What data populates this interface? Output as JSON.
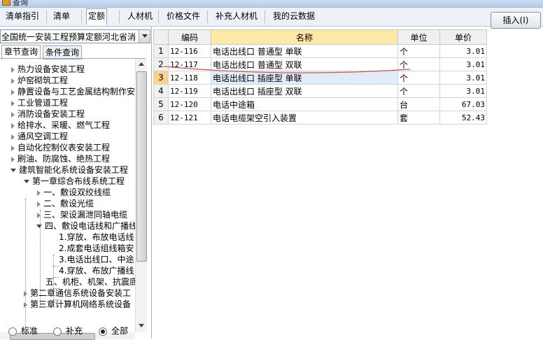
{
  "window": {
    "title": "查询"
  },
  "tabs": [
    {
      "label": "清单指引",
      "active": false
    },
    {
      "label": "清单",
      "active": false
    },
    {
      "label": "定额",
      "active": true
    },
    {
      "label": "人材机",
      "active": false
    },
    {
      "label": "价格文件",
      "active": false
    },
    {
      "label": "补充人材机",
      "active": false
    },
    {
      "label": "我的云数据",
      "active": false
    }
  ],
  "insert_button": "插入(I)",
  "library": {
    "selected": "全国统一安装工程预算定额河北省消"
  },
  "subtabs": [
    {
      "label": "章节查询",
      "active": true
    },
    {
      "label": "条件查询",
      "active": false
    }
  ],
  "tree": [
    {
      "label": "热力设备安装工程",
      "state": "closed"
    },
    {
      "label": "炉窑砌筑工程",
      "state": "closed"
    },
    {
      "label": "静置设备与工艺金属结构制作安",
      "state": "closed"
    },
    {
      "label": "工业管道工程",
      "state": "closed"
    },
    {
      "label": "消防设备安装工程",
      "state": "closed"
    },
    {
      "label": "给排水、采暖、燃气工程",
      "state": "closed"
    },
    {
      "label": "通风空调工程",
      "state": "closed"
    },
    {
      "label": "自动化控制仪表安装工程",
      "state": "closed"
    },
    {
      "label": "刷油、防腐蚀、绝热工程",
      "state": "closed"
    },
    {
      "label": "建筑智能化系统设备安装工程",
      "state": "open"
    },
    {
      "label": "第一章综合布线系统工程",
      "state": "open"
    },
    {
      "label": "一、敷设双绞线缆",
      "state": "closed"
    },
    {
      "label": "二、敷设光缆",
      "state": "closed"
    },
    {
      "label": "三、架设漏泄同轴电缆",
      "state": "closed"
    },
    {
      "label": "四、敷设电话线和广播线",
      "state": "open"
    },
    {
      "label": "1.穿放、布放电话线",
      "state": "leaf"
    },
    {
      "label": "2.成套电话组线箱安",
      "state": "leaf"
    },
    {
      "label": "3.电话出线口、中途",
      "state": "leaf"
    },
    {
      "label": "4.穿放、布放广播线",
      "state": "leaf"
    },
    {
      "label": "五、机柜、机架、抗震底",
      "state": "none"
    },
    {
      "label": "第二章通信系统设备安装工",
      "state": "closed"
    },
    {
      "label": "第三章计算机网络系统设备",
      "state": "closed"
    }
  ],
  "filters": [
    {
      "label": "标准",
      "checked": false
    },
    {
      "label": "补充",
      "checked": false
    },
    {
      "label": "全部",
      "checked": true
    }
  ],
  "table": {
    "columns": [
      "",
      "编码",
      "名称",
      "单位",
      "单价"
    ],
    "rows": [
      {
        "no": "1",
        "code": "12-116",
        "name": "电话出线口 普通型 单联",
        "unit": "个",
        "price": "3.01"
      },
      {
        "no": "2",
        "code": "12-117",
        "name": "电话出线口 普通型 双联",
        "unit": "个",
        "price": "3.01"
      },
      {
        "no": "3",
        "code": "12-118",
        "name": "电话出线口 插座型 单联",
        "unit": "个",
        "price": "3.01"
      },
      {
        "no": "4",
        "code": "12-119",
        "name": "电话出线口 插座型 双联",
        "unit": "个",
        "price": "3.01"
      },
      {
        "no": "5",
        "code": "12-120",
        "name": "电话中途箱",
        "unit": "台",
        "price": "67.03"
      },
      {
        "no": "6",
        "code": "12-121",
        "name": "电话电缆架空引入装置",
        "unit": "套",
        "price": "52.43"
      }
    ],
    "selected_row": 3
  },
  "colors": {
    "header_highlight": "#fde9a5",
    "selected_cell": "#e1ecf9",
    "annotation": "#d9534f"
  }
}
